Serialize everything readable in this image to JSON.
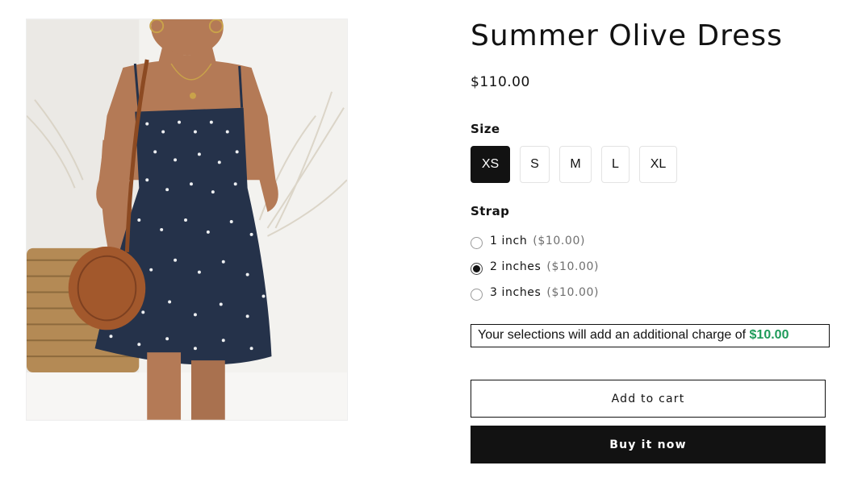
{
  "product": {
    "image_alt": "Woman wearing navy floral sundress with round rattan bag",
    "title": "Summer Olive Dress",
    "price": "$110.00"
  },
  "size": {
    "label": "Size",
    "options": [
      "XS",
      "S",
      "M",
      "L",
      "XL"
    ],
    "selected": "XS"
  },
  "strap": {
    "label": "Strap",
    "options": [
      {
        "name": "1 inch",
        "price": "($10.00)",
        "checked": false
      },
      {
        "name": "2 inches",
        "price": "($10.00)",
        "checked": true
      },
      {
        "name": "3 inches",
        "price": "($10.00)",
        "checked": false
      }
    ]
  },
  "charge": {
    "text": "Your selections will add an additional charge of",
    "amount": "$10.00",
    "amount_color": "#1e9b5a"
  },
  "actions": {
    "add_to_cart": "Add to cart",
    "buy_now": "Buy it now"
  },
  "colors": {
    "primary": "#121212",
    "accent_green": "#1e9b5a"
  }
}
